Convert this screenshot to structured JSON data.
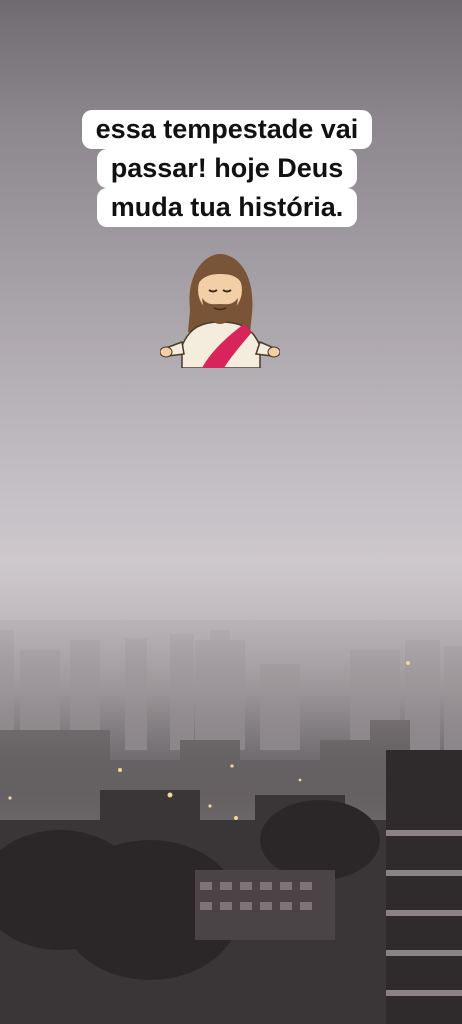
{
  "caption": {
    "lines": [
      "essa tempestade vai",
      "passar! hoje Deus",
      "muda tua história."
    ]
  },
  "sticker": {
    "icon": "jesus-emoji-icon"
  },
  "colors": {
    "sky": "#c2bdc2",
    "caption_bg": "#ffffff",
    "caption_text": "#111111",
    "robe_sash": "#d8245a"
  }
}
